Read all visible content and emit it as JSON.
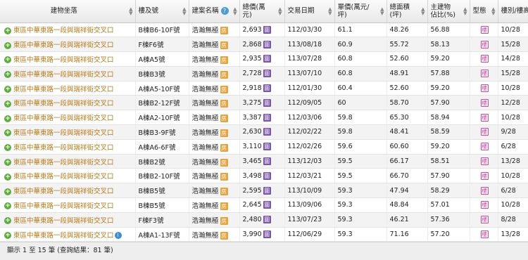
{
  "headers": [
    "建物坐落",
    "樓及號",
    "建案名稱",
    "總價(萬元)",
    "交易日期",
    "單價(萬元/坪)",
    "總面積\n(坪)",
    "主建物\n佔比(%)",
    "型態",
    "樓別/樓高"
  ],
  "badges": {
    "case": "房",
    "price": "圖",
    "type": "樓"
  },
  "rows": [
    {
      "addr": "東區中華東路一段與瑞祥街交叉口",
      "unit": "B棟B6-10F號",
      "case": "浩瀚無極",
      "total": "2,693",
      "date": "112/03/30",
      "unit_price": "61.1",
      "area": "48.26",
      "ratio": "56.88",
      "floor": "10/28"
    },
    {
      "addr": "東區中華東路一段與瑞祥街交叉口",
      "unit": "F棟F6號",
      "case": "浩瀚無極",
      "total": "2,868",
      "date": "113/08/18",
      "unit_price": "60.9",
      "area": "55.72",
      "ratio": "58.13",
      "floor": "15/28"
    },
    {
      "addr": "東區中華東路一段與瑞祥街交叉口",
      "unit": "A棟A5號",
      "case": "浩瀚無極",
      "total": "2,935",
      "date": "113/07/28",
      "unit_price": "60.8",
      "area": "52.60",
      "ratio": "59.20",
      "floor": "14/28"
    },
    {
      "addr": "東區中華東路一段與瑞祥街交叉口",
      "unit": "B棟B3號",
      "case": "浩瀚無極",
      "total": "2,728",
      "date": "113/07/10",
      "unit_price": "60.8",
      "area": "48.91",
      "ratio": "57.88",
      "floor": "15/28"
    },
    {
      "addr": "東區中華東路一段與瑞祥街交叉口",
      "unit": "A棟A5-10F號",
      "case": "浩瀚無極",
      "total": "2,918",
      "date": "112/01/30",
      "unit_price": "60.4",
      "area": "52.60",
      "ratio": "59.20",
      "floor": "10/28"
    },
    {
      "addr": "東區中華東路一段與瑞祥街交叉口",
      "unit": "B棟B2-12F號",
      "case": "浩瀚無極",
      "total": "3,275",
      "date": "112/09/05",
      "unit_price": "60",
      "area": "58.70",
      "ratio": "57.90",
      "floor": "12/28"
    },
    {
      "addr": "東區中華東路一段與瑞祥街交叉口",
      "unit": "A棟A2-10F號",
      "case": "浩瀚無極",
      "total": "3,387",
      "date": "112/03/06",
      "unit_price": "59.8",
      "area": "65.30",
      "ratio": "58.94",
      "floor": "10/28"
    },
    {
      "addr": "東區中華東路一段與瑞祥街交叉口",
      "unit": "B棟B3-9F號",
      "case": "浩瀚無極",
      "total": "2,630",
      "date": "112/02/22",
      "unit_price": "59.8",
      "area": "48.41",
      "ratio": "58.59",
      "floor": "9/28"
    },
    {
      "addr": "東區中華東路一段與瑞祥街交叉口",
      "unit": "A棟A6-6F號",
      "case": "浩瀚無極",
      "total": "3,110",
      "date": "112/02/26",
      "unit_price": "59.6",
      "area": "60.60",
      "ratio": "59.20",
      "floor": "6/28"
    },
    {
      "addr": "東區中華東路一段與瑞祥街交叉口",
      "unit": "B棟B2號",
      "case": "浩瀚無極",
      "total": "3,465",
      "date": "113/12/03",
      "unit_price": "59.5",
      "area": "66.17",
      "ratio": "58.51",
      "floor": "13/28"
    },
    {
      "addr": "東區中華東路一段與瑞祥街交叉口",
      "unit": "B棟B2-10F號",
      "case": "浩瀚無極",
      "total": "3,498",
      "date": "112/03/21",
      "unit_price": "59.5",
      "area": "66.70",
      "ratio": "57.90",
      "floor": "10/28"
    },
    {
      "addr": "東區中華東路一段與瑞祥街交叉口",
      "unit": "B棟B5號",
      "case": "浩瀚無極",
      "total": "2,595",
      "date": "113/10/09",
      "unit_price": "59.3",
      "area": "47.94",
      "ratio": "58.29",
      "floor": "6/28"
    },
    {
      "addr": "東區中華東路一段與瑞祥街交叉口",
      "unit": "B棟B5號",
      "case": "浩瀚無極",
      "total": "2,645",
      "date": "113/09/06",
      "unit_price": "59.3",
      "area": "48.84",
      "ratio": "57.01",
      "floor": "10/28"
    },
    {
      "addr": "東區中華東路一段與瑞祥街交叉口",
      "unit": "F棟F3號",
      "case": "浩瀚無極",
      "total": "2,480",
      "date": "113/07/23",
      "unit_price": "59.3",
      "area": "46.21",
      "ratio": "57.36",
      "floor": "8/28"
    },
    {
      "addr": "東區中華東路一段與瑞祥街交叉口",
      "unit": "A棟A1-13F號",
      "case": "浩瀚無極",
      "total": "3,990",
      "date": "112/06/29",
      "unit_price": "59.3",
      "area": "71.16",
      "ratio": "57.20",
      "floor": "13/28",
      "info": true
    }
  ],
  "footer": "顯示 1 至 15 筆 (查詢結果：81 筆)",
  "colors": {
    "address_text": "#b77a16",
    "expand_icon": "#5cae3a",
    "case_badge": "#e9a33c",
    "price_badge": "#7a55a8",
    "type_badge": "#d8459c",
    "info_icon": "#3b8ed4"
  }
}
